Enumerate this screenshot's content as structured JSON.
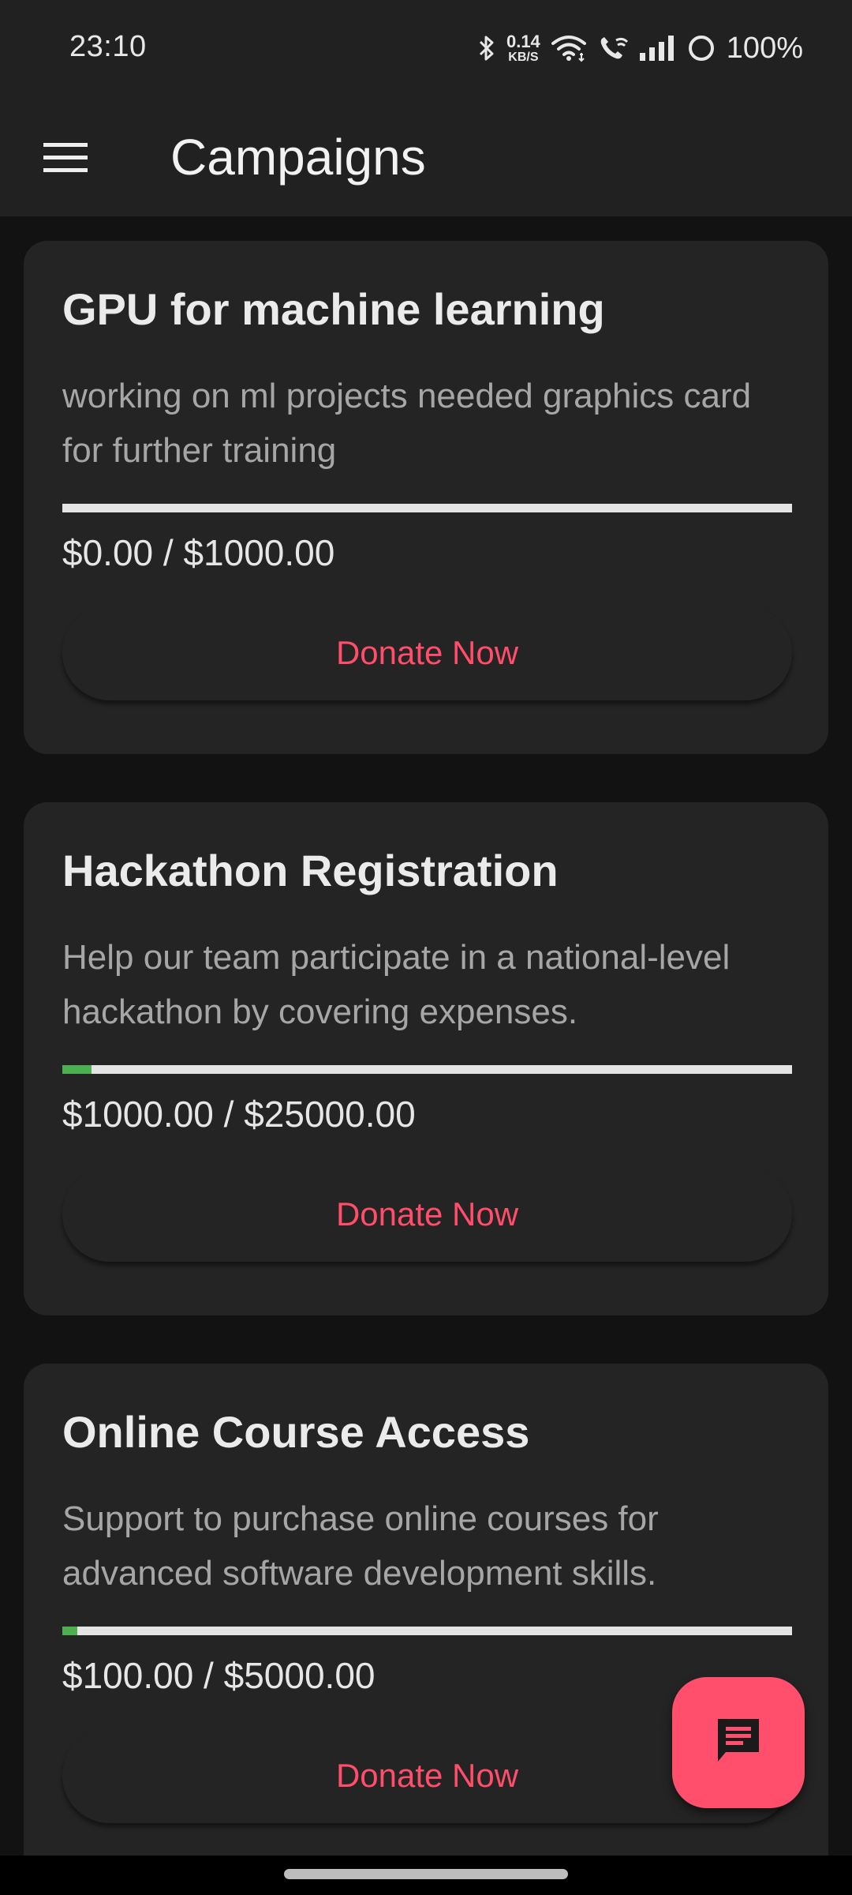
{
  "status_bar": {
    "time": "23:10",
    "net_speed_value": "0.14",
    "net_speed_unit": "KB/S",
    "battery": "100%",
    "icons": [
      "bluetooth-icon",
      "wifi-icon",
      "wifi-call-icon",
      "signal-icon",
      "battery-saver-icon"
    ]
  },
  "app_bar": {
    "menu_icon": "hamburger-menu-icon",
    "title": "Campaigns"
  },
  "campaigns": [
    {
      "title": "GPU for machine learning",
      "description": "working on ml projects needed graphics card for further training",
      "progress_fraction": 0.0,
      "amount": "$0.00 / $1000.00",
      "donate_label": "Donate Now"
    },
    {
      "title": "Hackathon Registration",
      "description": "Help our team participate in a national-level hackathon by covering expenses.",
      "progress_fraction": 0.04,
      "amount": "$1000.00 / $25000.00",
      "donate_label": "Donate Now"
    },
    {
      "title": "Online Course Access",
      "description": "Support to purchase online courses for advanced software development skills.",
      "progress_fraction": 0.02,
      "amount": "$100.00 / $5000.00",
      "donate_label": "Donate Now"
    }
  ],
  "fab": {
    "icon": "chat-icon"
  },
  "colors": {
    "accent": "#ff4f6d",
    "progress": "#4caf50",
    "card_bg": "#242424",
    "app_bg": "#121212"
  }
}
